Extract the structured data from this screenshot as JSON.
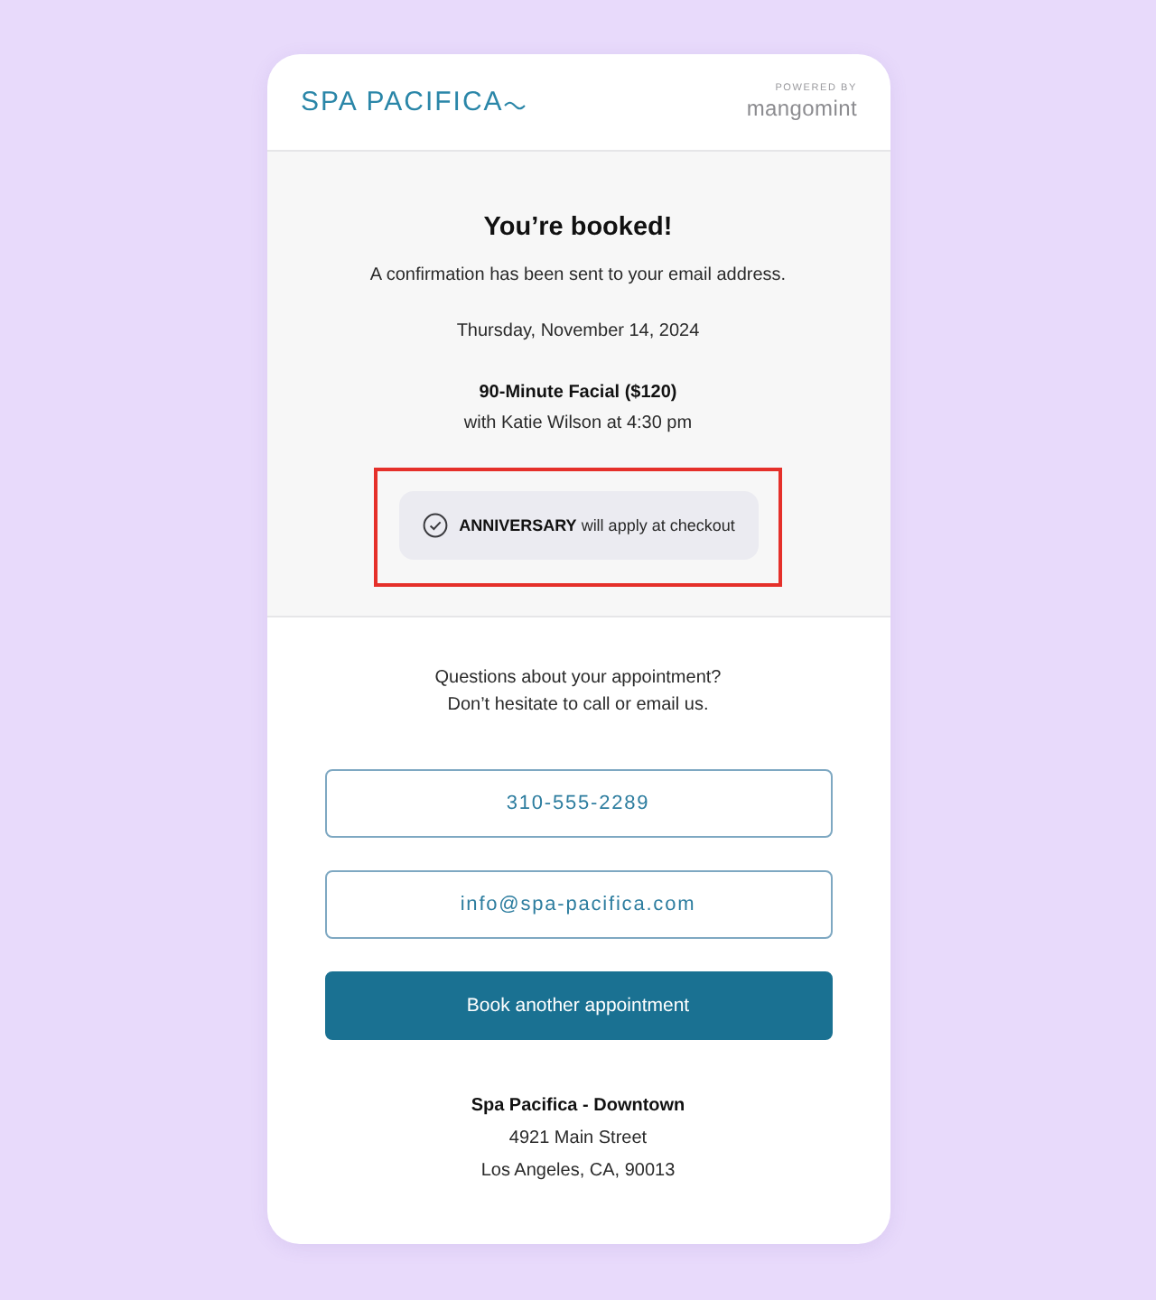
{
  "header": {
    "logo": "SPA PACIFICA",
    "powered_by": "POWERED BY",
    "brand": "mangomint"
  },
  "confirmation": {
    "title": "You’re booked!",
    "message": "A confirmation has been sent to your email address.",
    "date": "Thursday, November 14, 2024",
    "service": "90-Minute Facial ($120)",
    "details": "with Katie Wilson at 4:30 pm"
  },
  "promo": {
    "text": "**ANNIVERSARY** will apply at checkout",
    "applied": true,
    "highlighted": true
  },
  "contact": {
    "lines": [
      "Questions about your appointment?",
      "Don’t hesitate to call or email us."
    ],
    "buttons": [
      {
        "kind": "outline",
        "label": "310-555-2289"
      },
      {
        "kind": "outline",
        "label": "info@spa-pacifica.com"
      },
      {
        "kind": "primary",
        "label": "Book another appointment"
      }
    ]
  },
  "location": {
    "name": "Spa Pacifica - Downtown",
    "street": "4921 Main Street",
    "city": "Los Angeles, CA, 90013"
  }
}
